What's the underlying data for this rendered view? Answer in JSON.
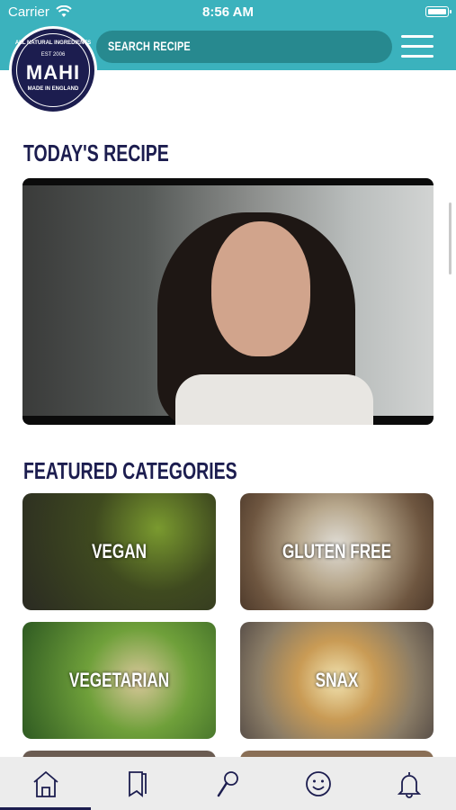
{
  "status_bar": {
    "carrier": "Carrier",
    "time": "8:56 AM"
  },
  "logo": {
    "top_text": "ALL NATURAL INGREDIENTS",
    "est": "EST 2006",
    "name": "MAHI",
    "bottom_text": "MADE IN ENGLAND"
  },
  "search": {
    "placeholder": "SEARCH RECIPE"
  },
  "sections": {
    "today": "TODAY'S RECIPE",
    "featured": "FEATURED CATEGORIES"
  },
  "categories": [
    {
      "label": "VEGAN"
    },
    {
      "label": "GLUTEN FREE"
    },
    {
      "label": "VEGETARIAN"
    },
    {
      "label": "SNAX"
    }
  ],
  "tabs": [
    {
      "icon": "home-icon",
      "active": true
    },
    {
      "icon": "recipe-book-icon",
      "active": false
    },
    {
      "icon": "search-icon",
      "active": false
    },
    {
      "icon": "smiley-icon",
      "active": false
    },
    {
      "icon": "bell-icon",
      "active": false
    }
  ],
  "colors": {
    "brand_teal": "#3bb2bd",
    "search_teal": "#27898f",
    "navy": "#1c1d4f",
    "tabbar": "#ececec"
  }
}
